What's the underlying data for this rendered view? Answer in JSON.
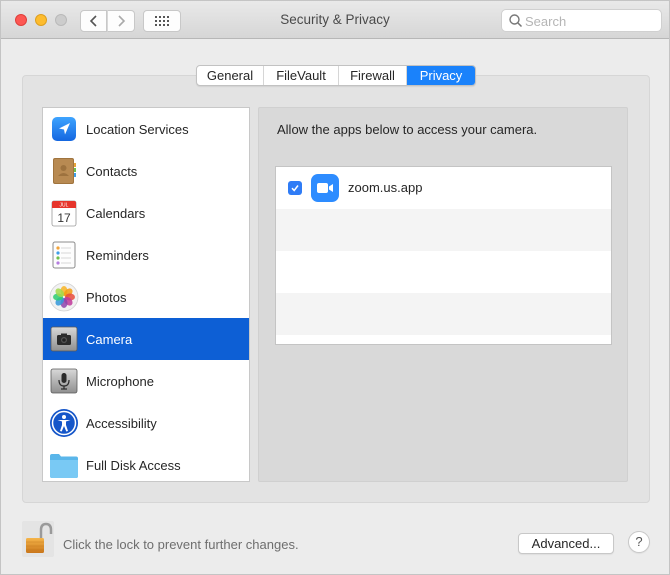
{
  "window": {
    "title": "Security & Privacy",
    "search_placeholder": "Search"
  },
  "tabs": [
    {
      "label": "General",
      "active": false
    },
    {
      "label": "FileVault",
      "active": false
    },
    {
      "label": "Firewall",
      "active": false
    },
    {
      "label": "Privacy",
      "active": true
    }
  ],
  "sidebar": {
    "selected": "Camera",
    "items": [
      {
        "label": "Location Services",
        "icon": "location-arrow-icon"
      },
      {
        "label": "Contacts",
        "icon": "contacts-book-icon"
      },
      {
        "label": "Calendars",
        "icon": "calendar-icon",
        "icon_text": "17",
        "icon_month": "JUL"
      },
      {
        "label": "Reminders",
        "icon": "reminders-list-icon"
      },
      {
        "label": "Photos",
        "icon": "photos-flower-icon"
      },
      {
        "label": "Camera",
        "icon": "camera-icon"
      },
      {
        "label": "Microphone",
        "icon": "microphone-icon"
      },
      {
        "label": "Accessibility",
        "icon": "accessibility-person-icon"
      },
      {
        "label": "Full Disk Access",
        "icon": "folder-icon"
      }
    ]
  },
  "pane": {
    "description": "Allow the apps below to access your camera.",
    "apps": [
      {
        "name": "zoom.us.app",
        "checked": true,
        "icon": "zoom-video-icon"
      }
    ]
  },
  "footer": {
    "lock_text": "Click the lock to prevent further changes.",
    "advanced_label": "Advanced...",
    "help_label": "?"
  },
  "colors": {
    "accent": "#1a82fb",
    "selection": "#0d5fd5",
    "zoom_blue": "#2d8cff"
  }
}
